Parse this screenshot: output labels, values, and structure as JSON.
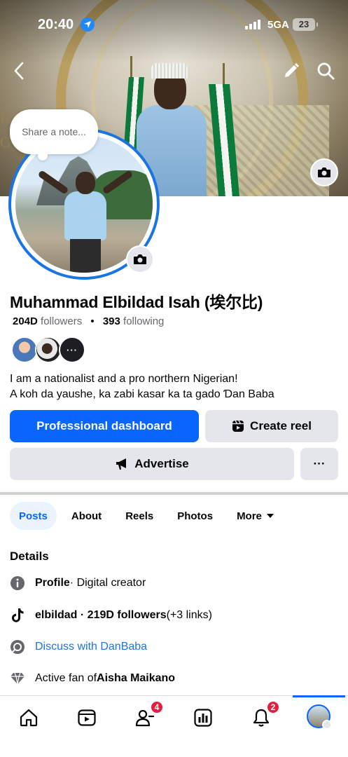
{
  "status_bar": {
    "time": "20:40",
    "network": "5GA",
    "battery": "23"
  },
  "note": {
    "placeholder": "Share a note..."
  },
  "profile": {
    "name": "Muhammad Elbildad Isah (埃尔比)",
    "followers_count": "204D",
    "followers_label": "followers",
    "following_count": "393",
    "following_label": "following",
    "bio_line1": "I am a nationalist and a pro northern Nigerian!",
    "bio_line2": "A koh da yaushe, ka zabi kasar ka ta gado Ɗan Baba"
  },
  "actions": {
    "professional_dashboard": "Professional dashboard",
    "create_reel": "Create reel",
    "advertise": "Advertise",
    "more": "···"
  },
  "tabs": [
    {
      "label": "Posts"
    },
    {
      "label": "About"
    },
    {
      "label": "Reels"
    },
    {
      "label": "Photos"
    },
    {
      "label": "More"
    }
  ],
  "details": {
    "heading": "Details",
    "profile_label": "Profile",
    "profile_value": " · Digital creator",
    "tiktok_handle": "elbildad · 219D followers",
    "tiktok_extra": " (+3 links)",
    "discuss_link": "Discuss with DanBaba",
    "fan_prefix": "Active fan of ",
    "fan_name": "Aisha Maikano"
  },
  "bottom_nav": {
    "friends_badge": "4",
    "notifications_badge": "2"
  },
  "colors": {
    "accent": "#0866ff",
    "badge": "#e41e3f",
    "tab_active_bg": "#ebf3ff"
  }
}
